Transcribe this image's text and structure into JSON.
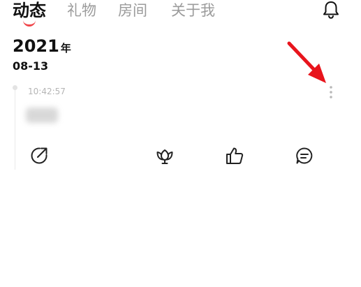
{
  "tabs": [
    {
      "label": "动态",
      "active": true
    },
    {
      "label": "礼物",
      "active": false
    },
    {
      "label": "房间",
      "active": false
    },
    {
      "label": "关于我",
      "active": false
    }
  ],
  "header": {
    "notification_icon": "bell-icon"
  },
  "feed": {
    "year": "2021",
    "year_unit": "年",
    "month_day": "08-13",
    "post": {
      "time": "10:42:57",
      "content_blurred": true,
      "actions": [
        {
          "icon": "share-icon"
        },
        {
          "icon": "gift-icon"
        },
        {
          "icon": "like-icon"
        },
        {
          "icon": "comment-icon"
        }
      ]
    }
  },
  "colors": {
    "accent": "#f0474b",
    "annotation_arrow": "#e8141c",
    "muted_text": "#9b9b9b"
  }
}
